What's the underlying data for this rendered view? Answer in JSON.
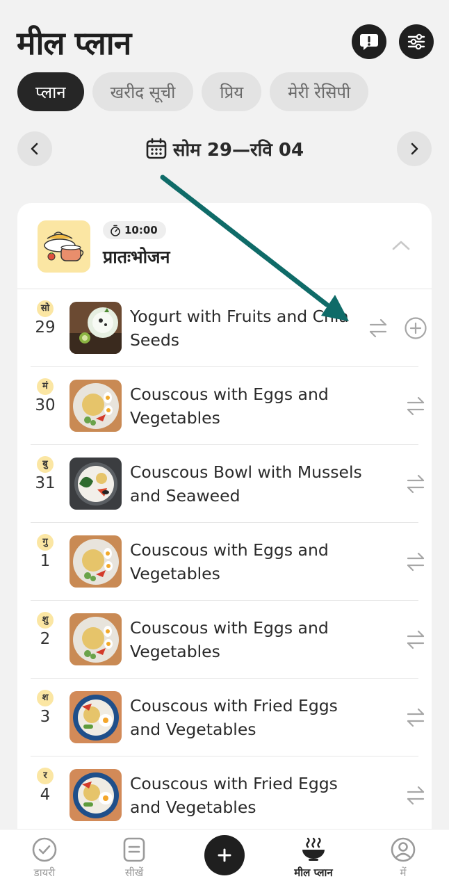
{
  "header": {
    "title": "मील प्लान"
  },
  "tabs": [
    {
      "label": "प्लान",
      "active": true
    },
    {
      "label": "खरीद सूची",
      "active": false
    },
    {
      "label": "प्रिय",
      "active": false
    },
    {
      "label": "मेरी रेसिपी",
      "active": false
    }
  ],
  "week": {
    "range": "सोम 29—रवि 04"
  },
  "meal": {
    "time": "10:00",
    "name": "प्रातःभोजन"
  },
  "rows": [
    {
      "day": "सो",
      "date": "29",
      "dish": "Yogurt with Fruits and Chia Seeds"
    },
    {
      "day": "मं",
      "date": "30",
      "dish": "Couscous with Eggs and Vegetables"
    },
    {
      "day": "बु",
      "date": "31",
      "dish": "Couscous Bowl with Mussels and Seaweed"
    },
    {
      "day": "गु",
      "date": "1",
      "dish": "Couscous with Eggs and Vegetables"
    },
    {
      "day": "शु",
      "date": "2",
      "dish": "Couscous with Eggs and Vegetables"
    },
    {
      "day": "श",
      "date": "3",
      "dish": "Couscous with Fried Eggs and Vegetables"
    },
    {
      "day": "र",
      "date": "4",
      "dish": "Couscous with Fried Eggs and Vegetables"
    }
  ],
  "bottom_nav": [
    {
      "label": "डायरी",
      "icon": "check-circle-icon",
      "active": false
    },
    {
      "label": "सीखें",
      "icon": "book-icon",
      "active": false
    },
    {
      "label": "",
      "icon": "plus-icon",
      "active": false
    },
    {
      "label": "मील प्लान",
      "icon": "steaming-bowl-icon",
      "active": true
    },
    {
      "label": "में",
      "icon": "profile-icon",
      "active": false
    }
  ],
  "colors": {
    "accent_dark": "#1f1f1f",
    "arrow": "#0f6b68",
    "day_badge": "#fbe6a3"
  }
}
